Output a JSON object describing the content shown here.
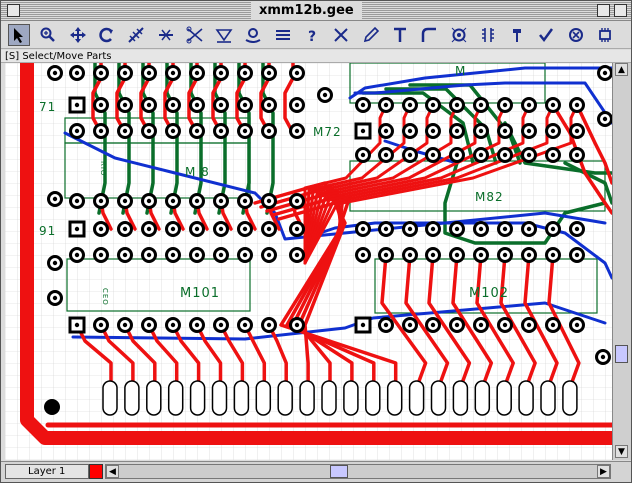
{
  "window": {
    "title": "xmm12b.gee"
  },
  "toolbar": {
    "tools": [
      {
        "icon": "select-arrow-icon"
      },
      {
        "icon": "zoom-icon"
      },
      {
        "icon": "move-icon"
      },
      {
        "icon": "rotate-icon"
      },
      {
        "icon": "net-icon"
      },
      {
        "icon": "route-icon"
      },
      {
        "icon": "cut-icon"
      },
      {
        "icon": "flip-icon"
      },
      {
        "icon": "pad-icon"
      },
      {
        "icon": "bus-icon"
      },
      {
        "icon": "help-icon"
      },
      {
        "icon": "delete-icon"
      },
      {
        "icon": "pencil-icon"
      },
      {
        "icon": "text-icon"
      },
      {
        "icon": "corner-icon"
      },
      {
        "icon": "target-icon"
      },
      {
        "icon": "pins-icon"
      },
      {
        "icon": "probe-icon"
      },
      {
        "icon": "check-icon"
      },
      {
        "icon": "part-icon"
      },
      {
        "icon": "chip-icon"
      }
    ]
  },
  "status": {
    "text": "[S] Select/Move Parts"
  },
  "board": {
    "labels": [
      {
        "id": "row71",
        "text": "71"
      },
      {
        "id": "row91",
        "text": "91"
      },
      {
        "id": "m72",
        "text": "M72"
      },
      {
        "id": "m81",
        "text": "M 8"
      },
      {
        "id": "m82",
        "text": "M82"
      },
      {
        "id": "m101",
        "text": "M101"
      },
      {
        "id": "m102",
        "text": "M102"
      },
      {
        "id": "mtop",
        "text": "M"
      },
      {
        "id": "small1",
        "text": "RIO"
      },
      {
        "id": "small2",
        "text": "CEO"
      }
    ],
    "colors": {
      "top_trace": "#ee1111",
      "bottom_trace": "#0a6e2a",
      "blue_trace": "#1030d0",
      "grid": "#c8c8c8"
    },
    "edge_fingers": 22
  },
  "footer": {
    "layer_label": "Layer 1",
    "layer_color": "#ff0000"
  }
}
